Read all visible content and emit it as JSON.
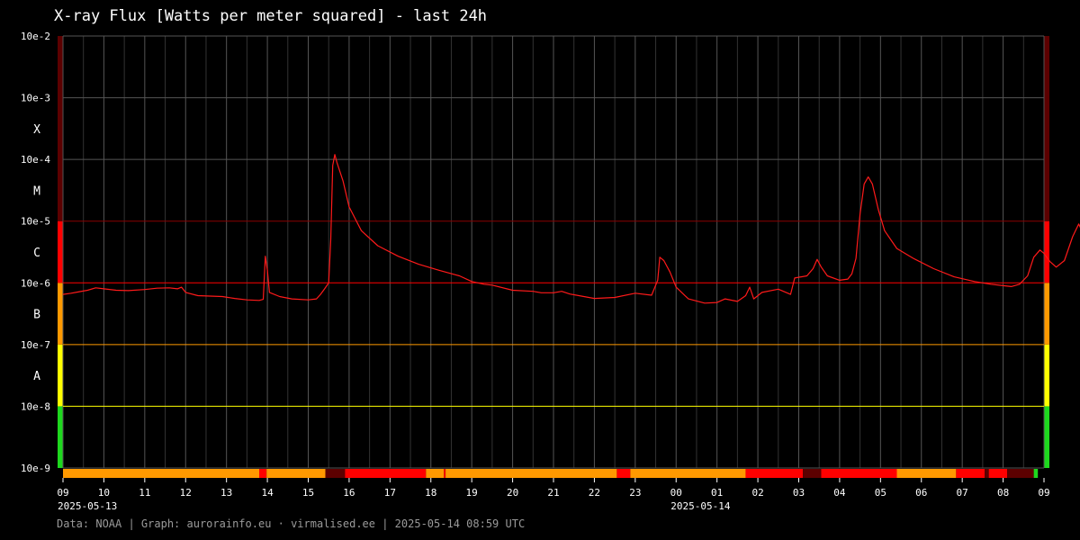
{
  "title": "X-ray Flux [Watts per meter squared] - last 24h",
  "footer": "Data: NOAA | Graph: aurorainfo.eu · virmalised.ee | 2025-05-14 08:59 UTC",
  "colors": {
    "background": "#000000",
    "line": "#ff1a1a",
    "grid": "#555555",
    "class_X": "#5c0000",
    "class_M": "#5c0000",
    "class_C": "#ff0000",
    "class_B": "#ff9900",
    "class_A": "#ffff00",
    "class_below_A": "#1ed81e"
  },
  "chart_data": {
    "type": "line",
    "title": "X-ray Flux [Watts per meter squared] - last 24h",
    "y_scale": "log",
    "ylim": [
      1e-09,
      0.01
    ],
    "y_ticks": [
      {
        "value": 1e-09,
        "label": "10e-9"
      },
      {
        "value": 1e-08,
        "label": "10e-8"
      },
      {
        "value": 1e-07,
        "label": "10e-7"
      },
      {
        "value": 1e-06,
        "label": "10e-6"
      },
      {
        "value": 1e-05,
        "label": "10e-5"
      },
      {
        "value": 0.0001,
        "label": "10e-4"
      },
      {
        "value": 0.001,
        "label": "10e-3"
      },
      {
        "value": 0.01,
        "label": "10e-2"
      }
    ],
    "flare_classes": [
      {
        "label": "A",
        "from": 1e-08,
        "to": 1e-07
      },
      {
        "label": "B",
        "from": 1e-07,
        "to": 1e-06
      },
      {
        "label": "C",
        "from": 1e-06,
        "to": 1e-05
      },
      {
        "label": "M",
        "from": 1e-05,
        "to": 0.0001
      },
      {
        "label": "X",
        "from": 0.0001,
        "to": 0.001
      }
    ],
    "x_ticks": [
      "09",
      "10",
      "11",
      "12",
      "13",
      "14",
      "15",
      "16",
      "17",
      "18",
      "19",
      "20",
      "21",
      "22",
      "23",
      "00",
      "01",
      "02",
      "03",
      "04",
      "05",
      "06",
      "07",
      "08",
      "09"
    ],
    "date_labels": [
      {
        "hour_index": 0,
        "label": "2025-05-13"
      },
      {
        "hour_index": 15,
        "label": "2025-05-14"
      }
    ],
    "grid": true,
    "series": [
      {
        "points": [
          [
            0.0,
            6.5e-07
          ],
          [
            0.2,
            6.8e-07
          ],
          [
            0.4,
            7.2e-07
          ],
          [
            0.6,
            7.6e-07
          ],
          [
            0.8,
            8.3e-07
          ],
          [
            1.0,
            8e-07
          ],
          [
            1.3,
            7.6e-07
          ],
          [
            1.6,
            7.5e-07
          ],
          [
            2.0,
            7.8e-07
          ],
          [
            2.3,
            8.2e-07
          ],
          [
            2.6,
            8.3e-07
          ],
          [
            2.8,
            8e-07
          ],
          [
            2.9,
            8.5e-07
          ],
          [
            3.0,
            7e-07
          ],
          [
            3.3,
            6.2e-07
          ],
          [
            3.6,
            6.1e-07
          ],
          [
            3.9,
            6e-07
          ],
          [
            4.2,
            5.6e-07
          ],
          [
            4.5,
            5.3e-07
          ],
          [
            4.8,
            5.2e-07
          ],
          [
            4.9,
            5.4e-07
          ],
          [
            4.95,
            2.7e-06
          ],
          [
            5.0,
            1.6e-06
          ],
          [
            5.05,
            7e-07
          ],
          [
            5.3,
            6e-07
          ],
          [
            5.6,
            5.5e-07
          ],
          [
            6.0,
            5.3e-07
          ],
          [
            6.2,
            5.5e-07
          ],
          [
            6.3,
            6.5e-07
          ],
          [
            6.4,
            8e-07
          ],
          [
            6.5,
            1e-06
          ],
          [
            6.55,
            5e-06
          ],
          [
            6.6,
            8e-05
          ],
          [
            6.65,
            0.00012
          ],
          [
            6.7,
            9e-05
          ],
          [
            6.85,
            4.5e-05
          ],
          [
            7.0,
            1.7e-05
          ],
          [
            7.3,
            7e-06
          ],
          [
            7.7,
            4e-06
          ],
          [
            8.2,
            2.7e-06
          ],
          [
            8.7,
            2e-06
          ],
          [
            9.2,
            1.6e-06
          ],
          [
            9.7,
            1.3e-06
          ],
          [
            10.0,
            1.05e-06
          ],
          [
            10.3,
            9.5e-07
          ],
          [
            10.5,
            9.2e-07
          ],
          [
            11.0,
            7.6e-07
          ],
          [
            11.5,
            7.3e-07
          ],
          [
            11.7,
            6.9e-07
          ],
          [
            12.0,
            6.9e-07
          ],
          [
            12.2,
            7.3e-07
          ],
          [
            12.4,
            6.6e-07
          ],
          [
            13.0,
            5.6e-07
          ],
          [
            13.5,
            5.8e-07
          ],
          [
            14.0,
            6.8e-07
          ],
          [
            14.4,
            6.3e-07
          ],
          [
            14.55,
            1.1e-06
          ],
          [
            14.6,
            2.6e-06
          ],
          [
            14.7,
            2.3e-06
          ],
          [
            14.85,
            1.5e-06
          ],
          [
            15.0,
            8.5e-07
          ],
          [
            15.3,
            5.5e-07
          ],
          [
            15.7,
            4.7e-07
          ],
          [
            16.0,
            4.8e-07
          ],
          [
            16.2,
            5.5e-07
          ],
          [
            16.5,
            5e-07
          ],
          [
            16.7,
            6.2e-07
          ],
          [
            16.8,
            8.5e-07
          ],
          [
            16.9,
            5.5e-07
          ],
          [
            17.1,
            7e-07
          ],
          [
            17.5,
            7.9e-07
          ],
          [
            17.8,
            6.5e-07
          ],
          [
            17.9,
            1.2e-06
          ],
          [
            18.2,
            1.3e-06
          ],
          [
            18.35,
            1.7e-06
          ],
          [
            18.45,
            2.4e-06
          ],
          [
            18.55,
            1.8e-06
          ],
          [
            18.7,
            1.3e-06
          ],
          [
            19.0,
            1.1e-06
          ],
          [
            19.2,
            1.15e-06
          ],
          [
            19.3,
            1.4e-06
          ],
          [
            19.4,
            2.5e-06
          ],
          [
            19.5,
            1.3e-05
          ],
          [
            19.6,
            4e-05
          ],
          [
            19.7,
            5.2e-05
          ],
          [
            19.8,
            4e-05
          ],
          [
            19.95,
            1.5e-05
          ],
          [
            20.1,
            7e-06
          ],
          [
            20.4,
            3.6e-06
          ],
          [
            20.8,
            2.5e-06
          ],
          [
            21.3,
            1.7e-06
          ],
          [
            21.8,
            1.25e-06
          ],
          [
            22.3,
            1.05e-06
          ],
          [
            22.7,
            9.5e-07
          ],
          [
            23.0,
            9e-07
          ],
          [
            23.2,
            8.7e-07
          ],
          [
            23.4,
            9.5e-07
          ],
          [
            23.6,
            1.3e-06
          ],
          [
            23.75,
            2.6e-06
          ],
          [
            23.9,
            3.4e-06
          ],
          [
            24.0,
            3e-06
          ],
          [
            24.15,
            2.2e-06
          ],
          [
            24.3,
            1.8e-06
          ],
          [
            24.5,
            2.3e-06
          ],
          [
            24.7,
            5.6e-06
          ],
          [
            24.85,
            9e-06
          ],
          [
            25.0,
            5.5e-06
          ],
          [
            25.2,
            3.2e-06
          ],
          [
            25.4,
            4e-06
          ],
          [
            25.5,
            9e-06
          ],
          [
            25.65,
            2.5e-05
          ],
          [
            25.8,
            3.1e-05
          ],
          [
            25.95,
            3e-05
          ],
          [
            26.1,
            1.3e-05
          ],
          [
            26.3,
            7.6e-06
          ],
          [
            26.45,
            1e-05
          ],
          [
            26.6,
            8e-06
          ]
        ]
      }
    ],
    "class_bar": [
      {
        "from": 0.0,
        "to": 4.8,
        "class": "B"
      },
      {
        "from": 4.8,
        "to": 4.98,
        "class": "C"
      },
      {
        "from": 4.98,
        "to": 6.42,
        "class": "B"
      },
      {
        "from": 6.42,
        "to": 6.9,
        "class": "M"
      },
      {
        "from": 6.9,
        "to": 8.88,
        "class": "C"
      },
      {
        "from": 8.88,
        "to": 9.32,
        "class": "B"
      },
      {
        "from": 9.32,
        "to": 9.36,
        "class": "C"
      },
      {
        "from": 9.36,
        "to": 13.55,
        "class": "B"
      },
      {
        "from": 13.55,
        "to": 13.88,
        "class": "C"
      },
      {
        "from": 13.88,
        "to": 16.7,
        "class": "B"
      },
      {
        "from": 16.7,
        "to": 18.1,
        "class": "C"
      },
      {
        "from": 18.1,
        "to": 18.55,
        "class": "M"
      },
      {
        "from": 18.55,
        "to": 20.4,
        "class": "C"
      },
      {
        "from": 20.4,
        "to": 21.85,
        "class": "B"
      },
      {
        "from": 21.85,
        "to": 22.55,
        "class": "C"
      },
      {
        "from": 22.55,
        "to": 22.65,
        "class": "M"
      },
      {
        "from": 22.65,
        "to": 23.1,
        "class": "C"
      },
      {
        "from": 23.1,
        "to": 23.75,
        "class": "M"
      },
      {
        "from": 23.75,
        "to": 23.85,
        "class": "below_A"
      }
    ]
  }
}
